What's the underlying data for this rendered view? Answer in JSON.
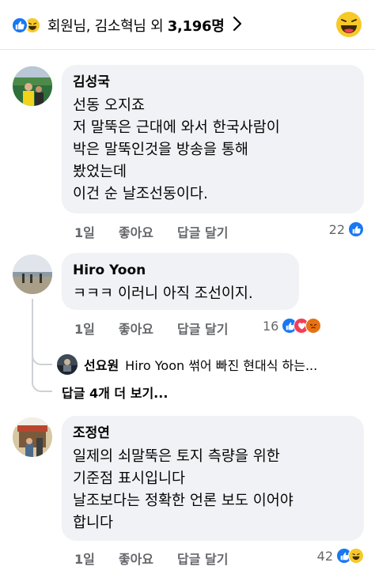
{
  "reactions": {
    "icons": [
      "like-icon",
      "haha-icon"
    ],
    "names": "회원님, 김소혁님 외",
    "count": "3,196명"
  },
  "comments": [
    {
      "author": "김성국",
      "text": "선동 오지죠\n저 말뚝은 근대에 와서 한국사람이\n박은 말뚝인것을 방송을 통해\n봤었는데\n이건 순 날조선동이다.",
      "time": "1일",
      "like_label": "좋아요",
      "reply_label": "답글 달기",
      "reaction_count": "22",
      "reaction_icons": [
        "like-icon"
      ]
    },
    {
      "author": "Hiro Yoon",
      "text": "ㅋㅋㅋ 이러니 아직 조선이지.",
      "time": "1일",
      "like_label": "좋아요",
      "reply_label": "답글 달기",
      "reaction_count": "16",
      "reaction_icons": [
        "like-icon",
        "love-icon",
        "angry-icon"
      ],
      "reply_preview": {
        "author": "선요원",
        "text": "Hiro Yoon 썪어 빠진 현대식 하는..."
      },
      "more_replies": "답글 4개 더 보기..."
    },
    {
      "author": "조정연",
      "text": "일제의 쇠말뚝은 토지 측량을 위한\n기준점 표시입니다\n날조보다는 정확한 언론 보도 이어야\n합니다",
      "time": "1일",
      "like_label": "좋아요",
      "reply_label": "답글 달기",
      "reaction_count": "42",
      "reaction_icons": [
        "like-icon",
        "haha-icon"
      ]
    }
  ],
  "colors": {
    "like": "#1877f2",
    "haha": "#f7c928",
    "love": "#f33e58",
    "angry": "#e9710f",
    "bubble": "#f0f2f5",
    "meta": "#65676b"
  }
}
